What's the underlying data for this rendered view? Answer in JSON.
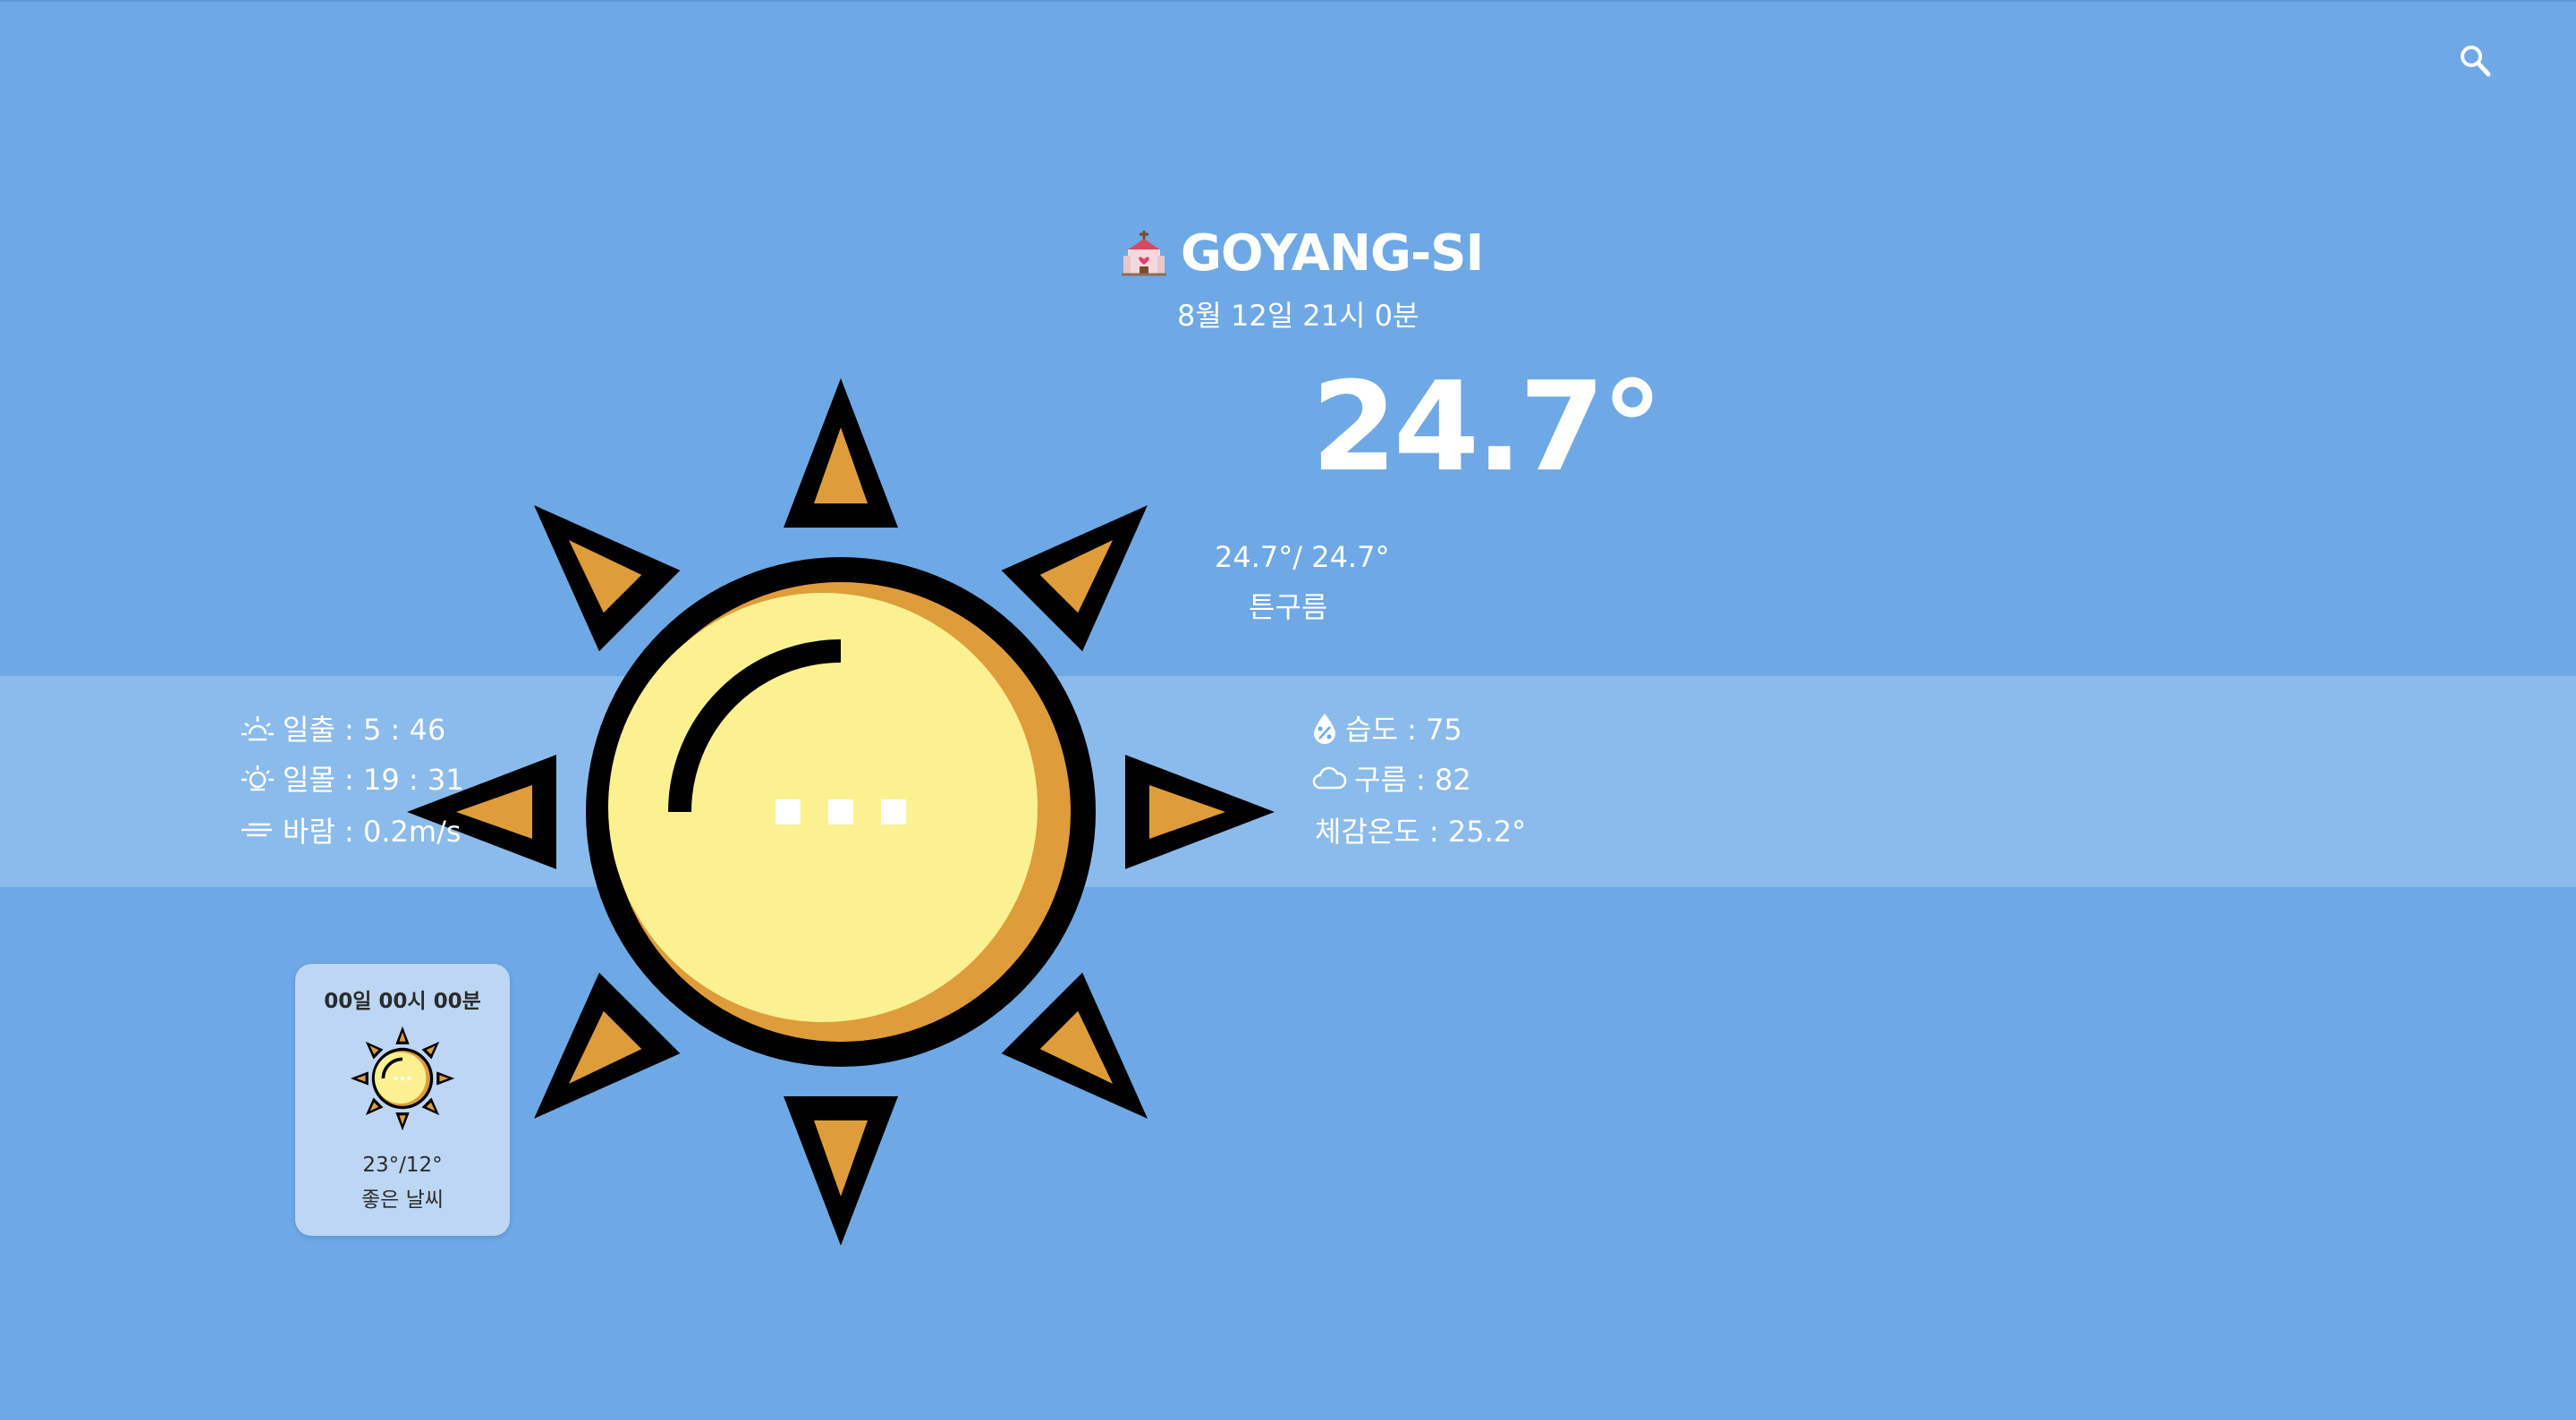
{
  "location": {
    "icon": "church-icon",
    "city": "GOYANG-SI",
    "datetime": "8월 12일 21시 0분"
  },
  "current": {
    "temperature": "24.7°",
    "min_max": "24.7°/ 24.7°",
    "description": "튼구름",
    "weather_icon": "sun-icon",
    "loading_indicator": "..."
  },
  "details_left": [
    {
      "icon": "sunrise-icon",
      "text": "일출 : 5 : 46"
    },
    {
      "icon": "sunset-icon",
      "text": "일몰 : 19 : 31"
    },
    {
      "icon": "wind-icon",
      "text": "바람 : 0.2m/s"
    }
  ],
  "details_right": [
    {
      "icon": "humidity-icon",
      "text": "습도 : 75"
    },
    {
      "icon": "cloud-icon",
      "text": "구름 : 82"
    },
    {
      "icon": "",
      "text": "체감온도 : 25.2°"
    }
  ],
  "forecast_card": {
    "time": "00일 00시 00분",
    "icon": "sun-icon",
    "temp": "23°/12°",
    "description": "좋은 날씨"
  },
  "header": {
    "search_icon": "search-icon"
  },
  "colors": {
    "background": "#6ea9e6",
    "band": "#8bbbeb",
    "card": "#bdd6f4",
    "sun_body": "#fbf191",
    "sun_shade": "#de9d3a",
    "outline": "#000000"
  }
}
